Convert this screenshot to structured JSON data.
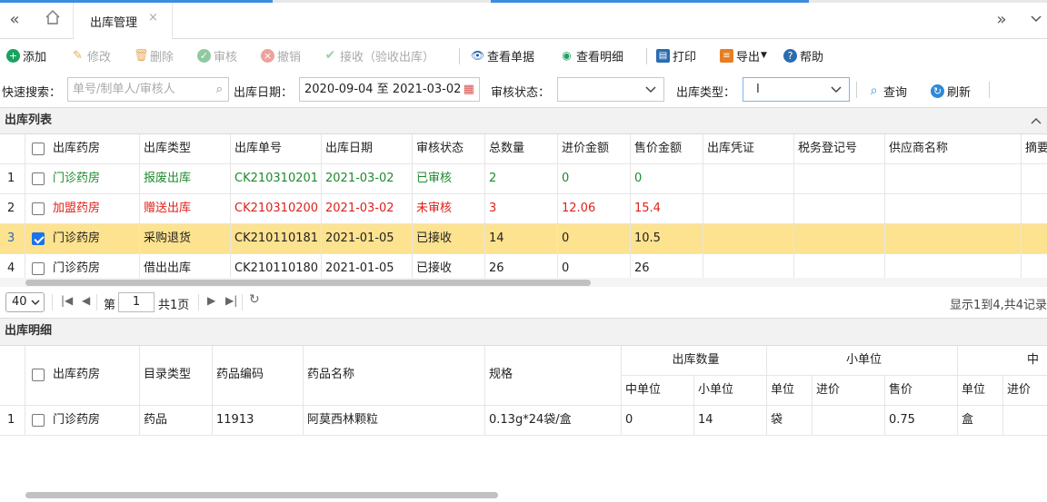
{
  "tabs": {
    "active_tab_label": "出库管理",
    "close_glyph": "×"
  },
  "toolbar": {
    "add": "添加",
    "edit": "修改",
    "delete": "删除",
    "audit": "审核",
    "revoke": "撤销",
    "receive": "接收（验收出库）",
    "view_doc": "查看单据",
    "view_detail": "查看明细",
    "print": "打印",
    "export": "导出",
    "help": "帮助"
  },
  "search": {
    "quick_label": "快速搜索：",
    "quick_placeholder": "单号/制单人/审核人",
    "date_label": "出库日期：",
    "date_value": "2020-09-04 至 2021-03-02",
    "audit_status_label": "审核状态：",
    "audit_status_value": "",
    "out_type_label": "出库类型：",
    "out_type_value": "",
    "query": "查询",
    "refresh": "刷新"
  },
  "list_panel": {
    "title": "出库列表",
    "columns": [
      "出库药房",
      "出库类型",
      "出库单号",
      "出库日期",
      "审核状态",
      "总数量",
      "进价金额",
      "售价金额",
      "出库凭证",
      "税务登记号",
      "供应商名称",
      "摘要"
    ],
    "rows": [
      {
        "num": "1",
        "checked": false,
        "color": "green",
        "pharmacy": "门诊药房",
        "type": "报废出库",
        "no": "CK210310201",
        "date": "2021-03-02",
        "status": "已审核",
        "qty": "2",
        "cost": "0",
        "price": "0"
      },
      {
        "num": "2",
        "checked": false,
        "color": "red",
        "pharmacy": "加盟药房",
        "type": "赠送出库",
        "no": "CK210310200",
        "date": "2021-03-02",
        "status": "未审核",
        "qty": "3",
        "cost": "12.06",
        "price": "15.4"
      },
      {
        "num": "3",
        "checked": true,
        "color": "normal",
        "pharmacy": "门诊药房",
        "type": "采购退货",
        "no": "CK210110181",
        "date": "2021-01-05",
        "status": "已接收",
        "qty": "14",
        "cost": "0",
        "price": "10.5"
      },
      {
        "num": "4",
        "checked": false,
        "color": "normal",
        "pharmacy": "门诊药房",
        "type": "借出出库",
        "no": "CK210110180",
        "date": "2021-01-05",
        "status": "已接收",
        "qty": "26",
        "cost": "0",
        "price": "26"
      }
    ]
  },
  "pager": {
    "page_size": "40",
    "page_prefix": "第",
    "page_value": "1",
    "page_total": "共1页",
    "info": "显示1到4,共4记录"
  },
  "detail_panel": {
    "title": "出库明细",
    "columns": [
      "出库药房",
      "目录类型",
      "药品编码",
      "药品名称",
      "规格"
    ],
    "group_out_qty": "出库数量",
    "group_small_unit": "小单位",
    "group_mid_unit": "中",
    "sub_mid": "中单位",
    "sub_small": "小单位",
    "sub_unit": "单位",
    "sub_cost": "进价",
    "sub_price": "售价",
    "sub_unit2": "单位",
    "sub_cost2": "进价",
    "rows": [
      {
        "num": "1",
        "pharmacy": "门诊药房",
        "cat": "药品",
        "code": "11913",
        "name": "阿莫西林颗粒",
        "spec": "0.13g*24袋/盒",
        "mid_qty": "0",
        "small_qty": "14",
        "unit": "袋",
        "cost": "",
        "price": "0.75",
        "unit2": "盒"
      }
    ]
  }
}
